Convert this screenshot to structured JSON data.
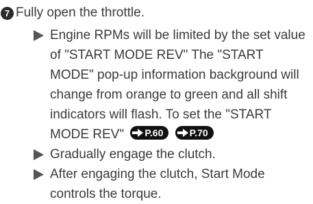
{
  "step": {
    "number": "7",
    "title": "Fully open the throttle."
  },
  "bullets": [
    {
      "text": "Engine RPMs will be limited by the set value of \"START MODE REV\" The \"START MODE\" pop-up information background will change from orange to green and all shift indicators will flash. To set the \"START MODE REV\"",
      "refs": [
        "P.60",
        "P.70"
      ]
    },
    {
      "text": "Gradually engage the clutch."
    },
    {
      "text": "After engaging the clutch, Start Mode controls the torque."
    }
  ],
  "icons": {
    "bullet": "triangle-bullet-icon",
    "ref": "arrow-right-icon"
  },
  "colors": {
    "text": "#3a3a3a",
    "badge": "#111111",
    "bullet": "#555555"
  }
}
